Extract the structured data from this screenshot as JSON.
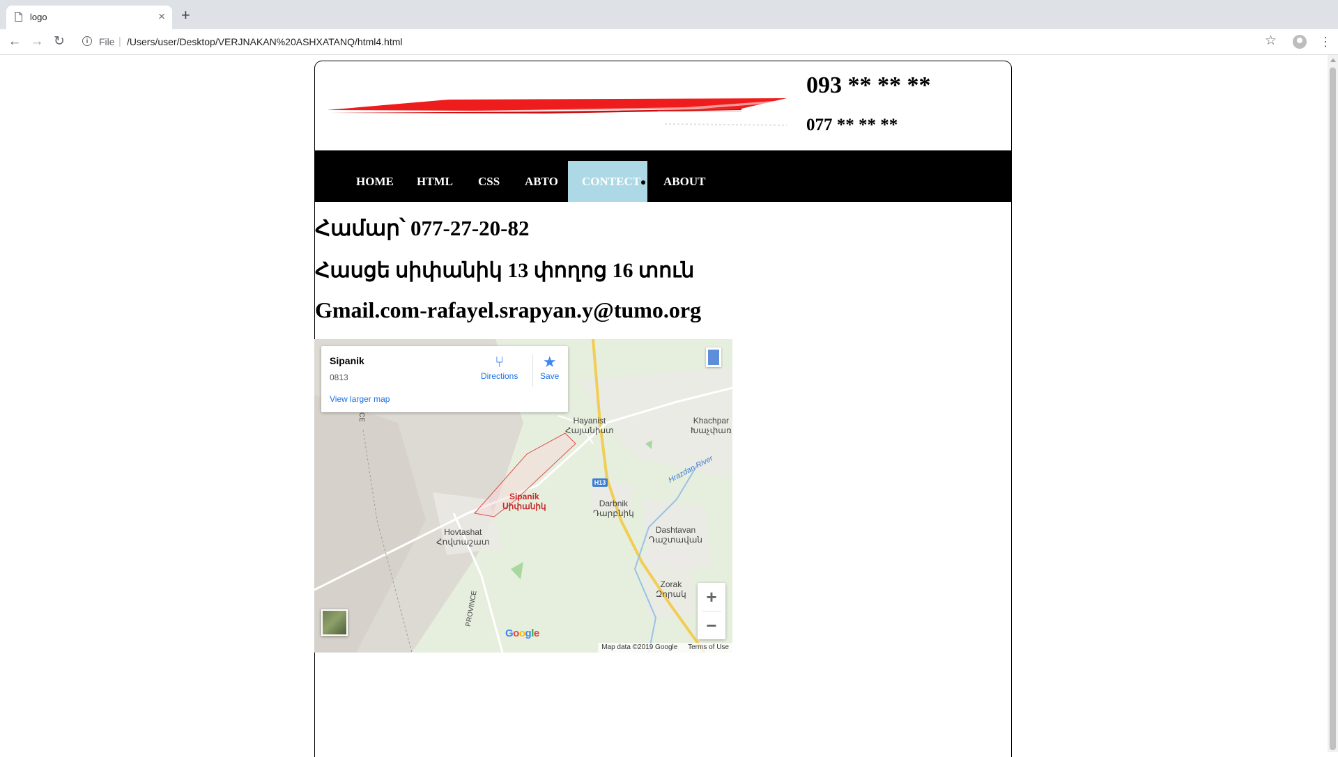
{
  "browser": {
    "tab_title": "logo",
    "tab_close": "×",
    "new_tab": "+",
    "back": "←",
    "forward": "→",
    "reload": "↻",
    "scheme_label": "File",
    "url": "/Users/user/Desktop/VERJNAKAN%20ASHXATANQ/html4.html",
    "bookmark": "☆",
    "menu": "⋮"
  },
  "header": {
    "phone_primary": "093 ** ** **",
    "phone_secondary": "077 ** ** **",
    "logo_color": "#ee1c1c"
  },
  "nav": {
    "items": [
      {
        "label": "HOME"
      },
      {
        "label": "HTML"
      },
      {
        "label": "CSS"
      },
      {
        "label": "ABTO"
      },
      {
        "label": "CONTECT"
      },
      {
        "label": "ABOUT"
      }
    ],
    "active_item": "CONTECT",
    "active_color": "#add8e6"
  },
  "contact": {
    "phone_line": "Համար՝ 077-27-20-82",
    "address_line": "Հասցե սիփանիկ 13 փողոց 16 տուն",
    "email_line": "Gmail.com-rafayel.srapyan.y@tumo.org"
  },
  "map": {
    "place_name": "Sipanik",
    "place_code": "0813",
    "directions_label": "Directions",
    "save_label": "Save",
    "view_larger": "View larger map",
    "zoom_in": "+",
    "zoom_out": "−",
    "google_logo": "Google",
    "map_data": "Map data ©2019 Google",
    "terms": "Terms of Use",
    "road_label": "H13",
    "labels": {
      "hayanist": "Hayanist\nՀայանիստ",
      "khachpar": "Khachpar\nԽաչփառ",
      "sipanik": "Sipanik\nՍիփանիկ",
      "darbnik": "Darbnik\nԴարբնիկ",
      "hovtashat": "Hovtashat\nՀովտաշատ",
      "dashtavan": "Dashtavan\nԴաշտավան",
      "zorak": "Zorak\nԶորակ",
      "river": "Hrazdan River",
      "province_top": "INCE",
      "province_bottom": "PROVINCE"
    }
  }
}
